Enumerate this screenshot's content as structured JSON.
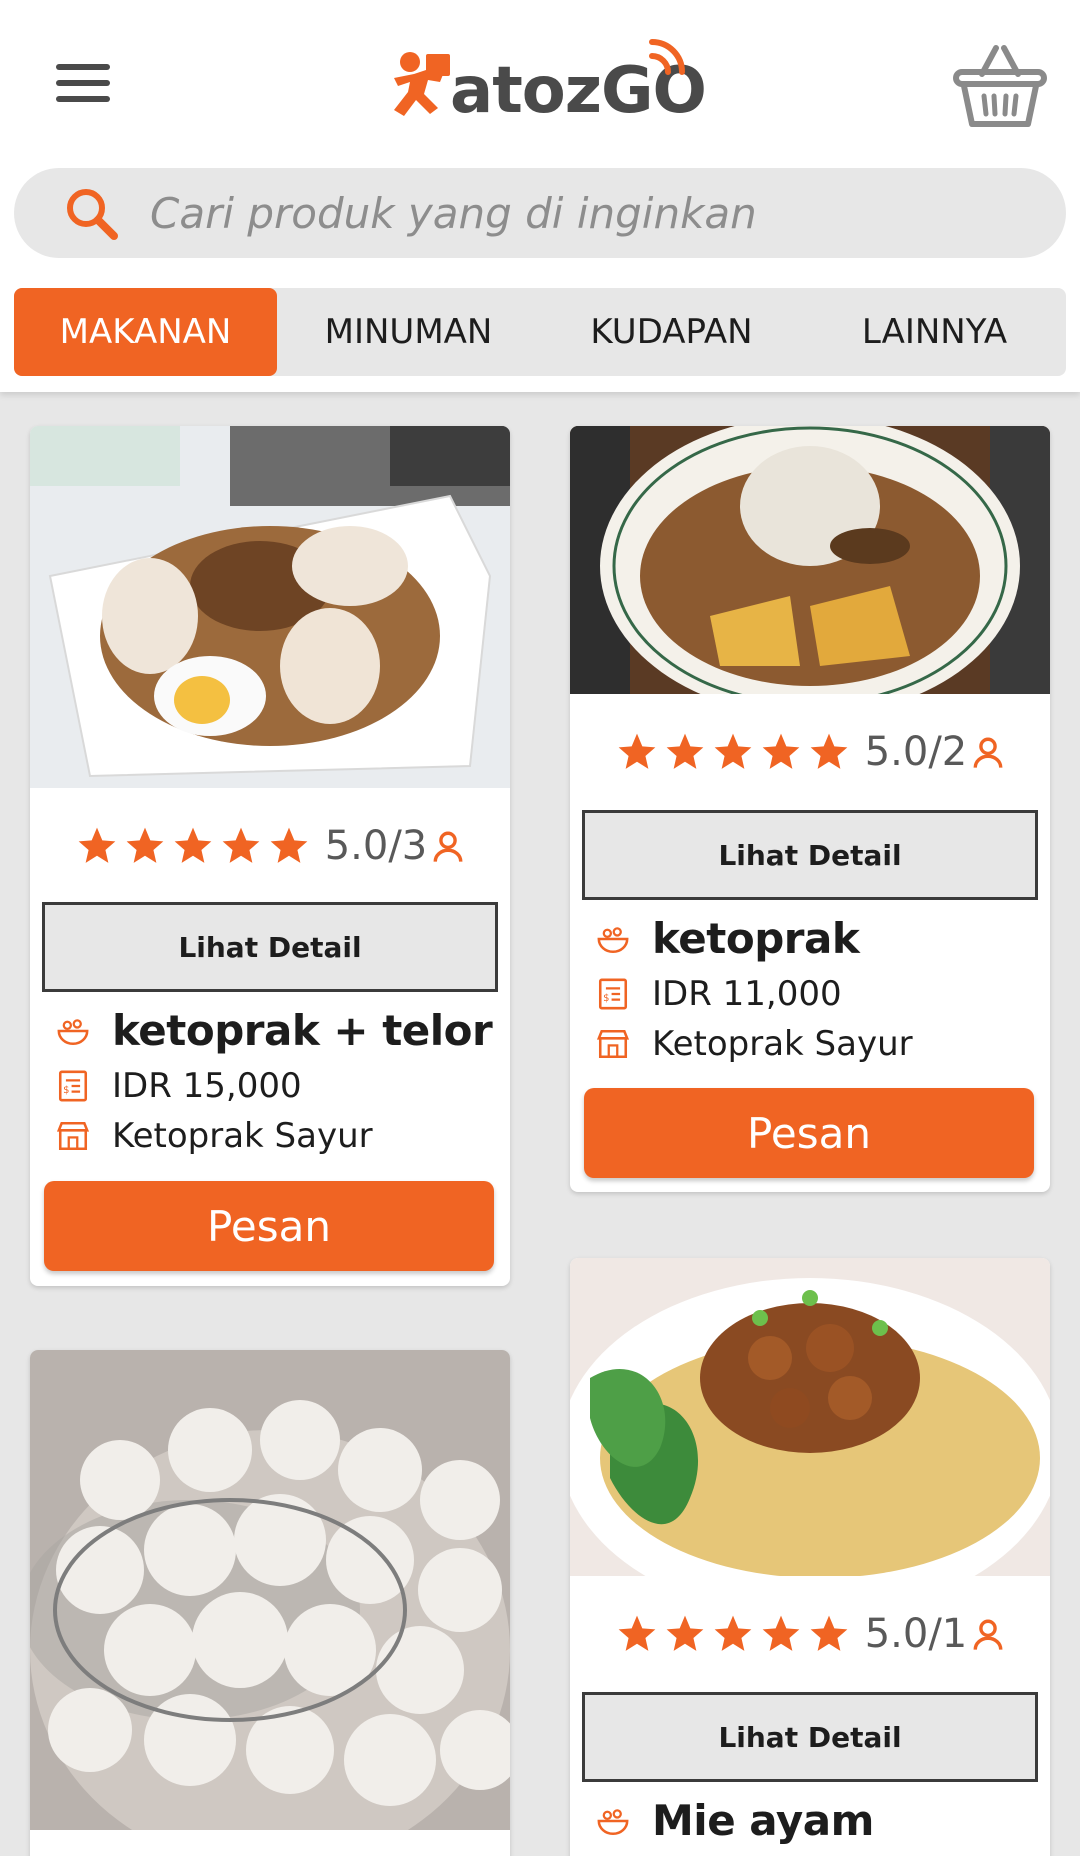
{
  "app": {
    "logo_text": "atozGO",
    "brand_color": "#f06423"
  },
  "search": {
    "placeholder": "Cari produk yang di inginkan"
  },
  "tabs": [
    {
      "label": "MAKANAN",
      "active": true
    },
    {
      "label": "MINUMAN",
      "active": false
    },
    {
      "label": "KUDAPAN",
      "active": false
    },
    {
      "label": "LAINNYA",
      "active": false
    }
  ],
  "products": [
    {
      "name": "ketoprak + telor",
      "rating": "5.0/3",
      "detail_label": "Lihat Detail",
      "price": "IDR 15,000",
      "store": "Ketoprak Sayur",
      "order_label": "Pesan"
    },
    {
      "name": "ketoprak",
      "rating": "5.0/2",
      "detail_label": "Lihat Detail",
      "price": "IDR 11,000",
      "store": "Ketoprak Sayur",
      "order_label": "Pesan"
    },
    {
      "name": "Mie ayam",
      "rating": "5.0/1",
      "detail_label": "Lihat Detail"
    }
  ]
}
